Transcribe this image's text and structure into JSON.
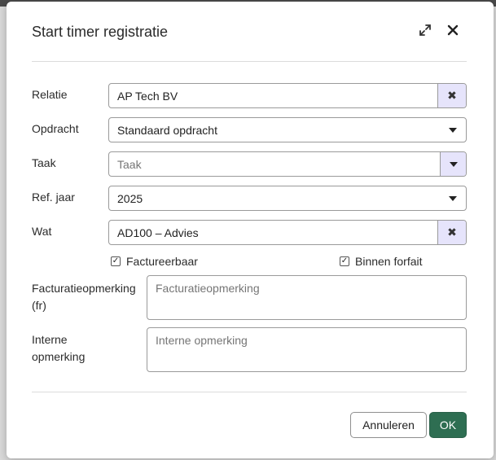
{
  "dialog": {
    "title": "Start timer registratie",
    "expand_icon": "expand-icon",
    "close_icon": "close-icon"
  },
  "form": {
    "relatie": {
      "label": "Relatie",
      "value": "AP Tech BV"
    },
    "opdracht": {
      "label": "Opdracht",
      "value": "Standaard opdracht"
    },
    "taak": {
      "label": "Taak",
      "placeholder": "Taak"
    },
    "ref_jaar": {
      "label": "Ref. jaar",
      "value": "2025"
    },
    "wat": {
      "label": "Wat",
      "value": "AD100 – Advies"
    },
    "factureerbaar": {
      "label": "Factureerbaar",
      "checked": true
    },
    "binnen_forfait": {
      "label": "Binnen forfait",
      "checked": true
    },
    "facturatieopmerking": {
      "label_line1": "Facturatieopmerking",
      "label_line2": "(fr)",
      "placeholder": "Facturatieopmerking"
    },
    "interne_opmerking": {
      "label_line1": "Interne",
      "label_line2": "opmerking",
      "placeholder": "Interne opmerking"
    }
  },
  "buttons": {
    "cancel": "Annuleren",
    "ok": "OK"
  },
  "colors": {
    "accent_clear": "#e6e4fb",
    "ok_button": "#2e6e52"
  }
}
